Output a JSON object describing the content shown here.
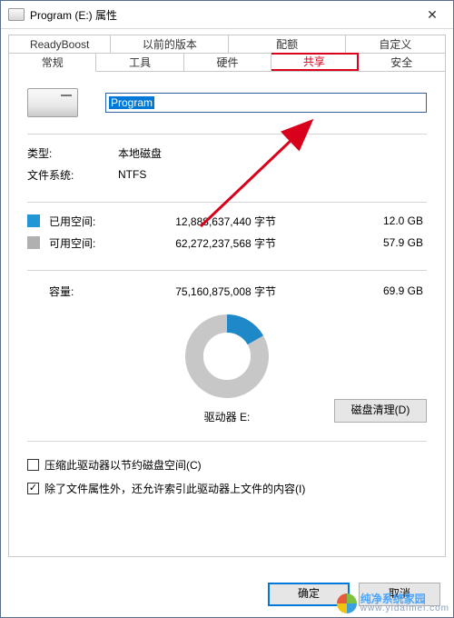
{
  "title": "Program (E:) 属性",
  "tabs_row1": [
    "ReadyBoost",
    "以前的版本",
    "配额",
    "自定义"
  ],
  "tabs_row2": [
    "常规",
    "工具",
    "硬件",
    "共享",
    "安全"
  ],
  "active_tab": "常规",
  "highlighted_tab": "共享",
  "drive_name": "Program",
  "type_label": "类型:",
  "type_value": "本地磁盘",
  "fs_label": "文件系统:",
  "fs_value": "NTFS",
  "used_label": "已用空间:",
  "used_bytes": "12,888,637,440 字节",
  "used_gb": "12.0 GB",
  "free_label": "可用空间:",
  "free_bytes": "62,272,237,568 字节",
  "free_gb": "57.9 GB",
  "capacity_label": "容量:",
  "capacity_bytes": "75,160,875,008 字节",
  "capacity_gb": "69.9 GB",
  "drive_letter_label": "驱动器 E:",
  "cleanup_label": "磁盘清理(D)",
  "compress_label": "压缩此驱动器以节约磁盘空间(C)",
  "compress_checked": false,
  "index_label": "除了文件属性外，还允许索引此驱动器上文件的内容(I)",
  "index_checked": true,
  "ok_label": "确定",
  "cancel_label": "取消",
  "watermark_text": "纯净系统家园",
  "watermark_url": "www.yidaimei.com",
  "chart_data": {
    "type": "pie",
    "title": "驱动器 E:",
    "categories": [
      "已用空间",
      "可用空间"
    ],
    "values": [
      12.0,
      57.9
    ],
    "unit": "GB",
    "colors": [
      "#2196d4",
      "#b0b0b0"
    ]
  }
}
